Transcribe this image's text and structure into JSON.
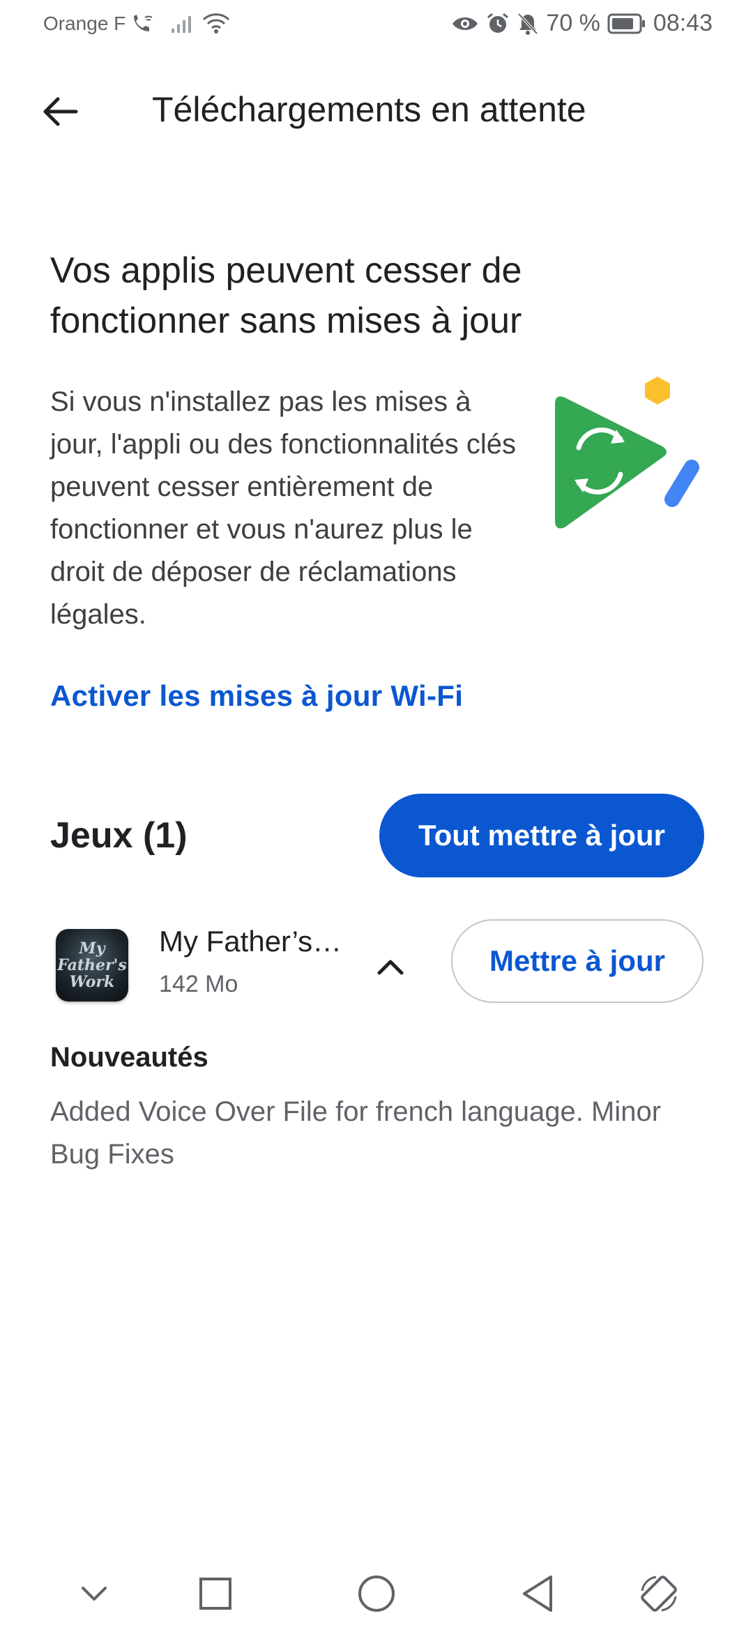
{
  "status_bar": {
    "carrier": "Orange F",
    "battery": "70 %",
    "time": "08:43"
  },
  "app_bar": {
    "title": "Téléchargements en attente"
  },
  "warning": {
    "title": "Vos applis peuvent cesser de fonctionner sans mises à jour",
    "body": "Si vous n'installez pas les mises à jour, l'appli ou des fonctionnalités clés peuvent cesser entièrement de fonctionner et vous n'aurez plus le droit de déposer de réclamations légales.",
    "link": "Activer les mises à jour Wi-Fi"
  },
  "games": {
    "title": "Jeux (1)",
    "update_all_label": "Tout mettre à jour",
    "apps": [
      {
        "name": "My Father’s…",
        "size": "142 Mo",
        "update_label": "Mettre à jour",
        "icon_text": "My Father's Work"
      }
    ]
  },
  "whats_new": {
    "title": "Nouveautés",
    "body": "Added Voice Over File for french language. Minor Bug Fixes"
  },
  "colors": {
    "accent": "#0b57d0",
    "illustration_green": "#34a853",
    "illustration_yellow": "#fbc02d",
    "illustration_blue": "#4285f4"
  },
  "icons": {
    "back": "arrow-back-icon",
    "expand": "chevron-up-icon",
    "nav": [
      "chevron-down-icon",
      "square-icon",
      "circle-icon",
      "triangle-back-icon",
      "rotate-icon"
    ]
  }
}
